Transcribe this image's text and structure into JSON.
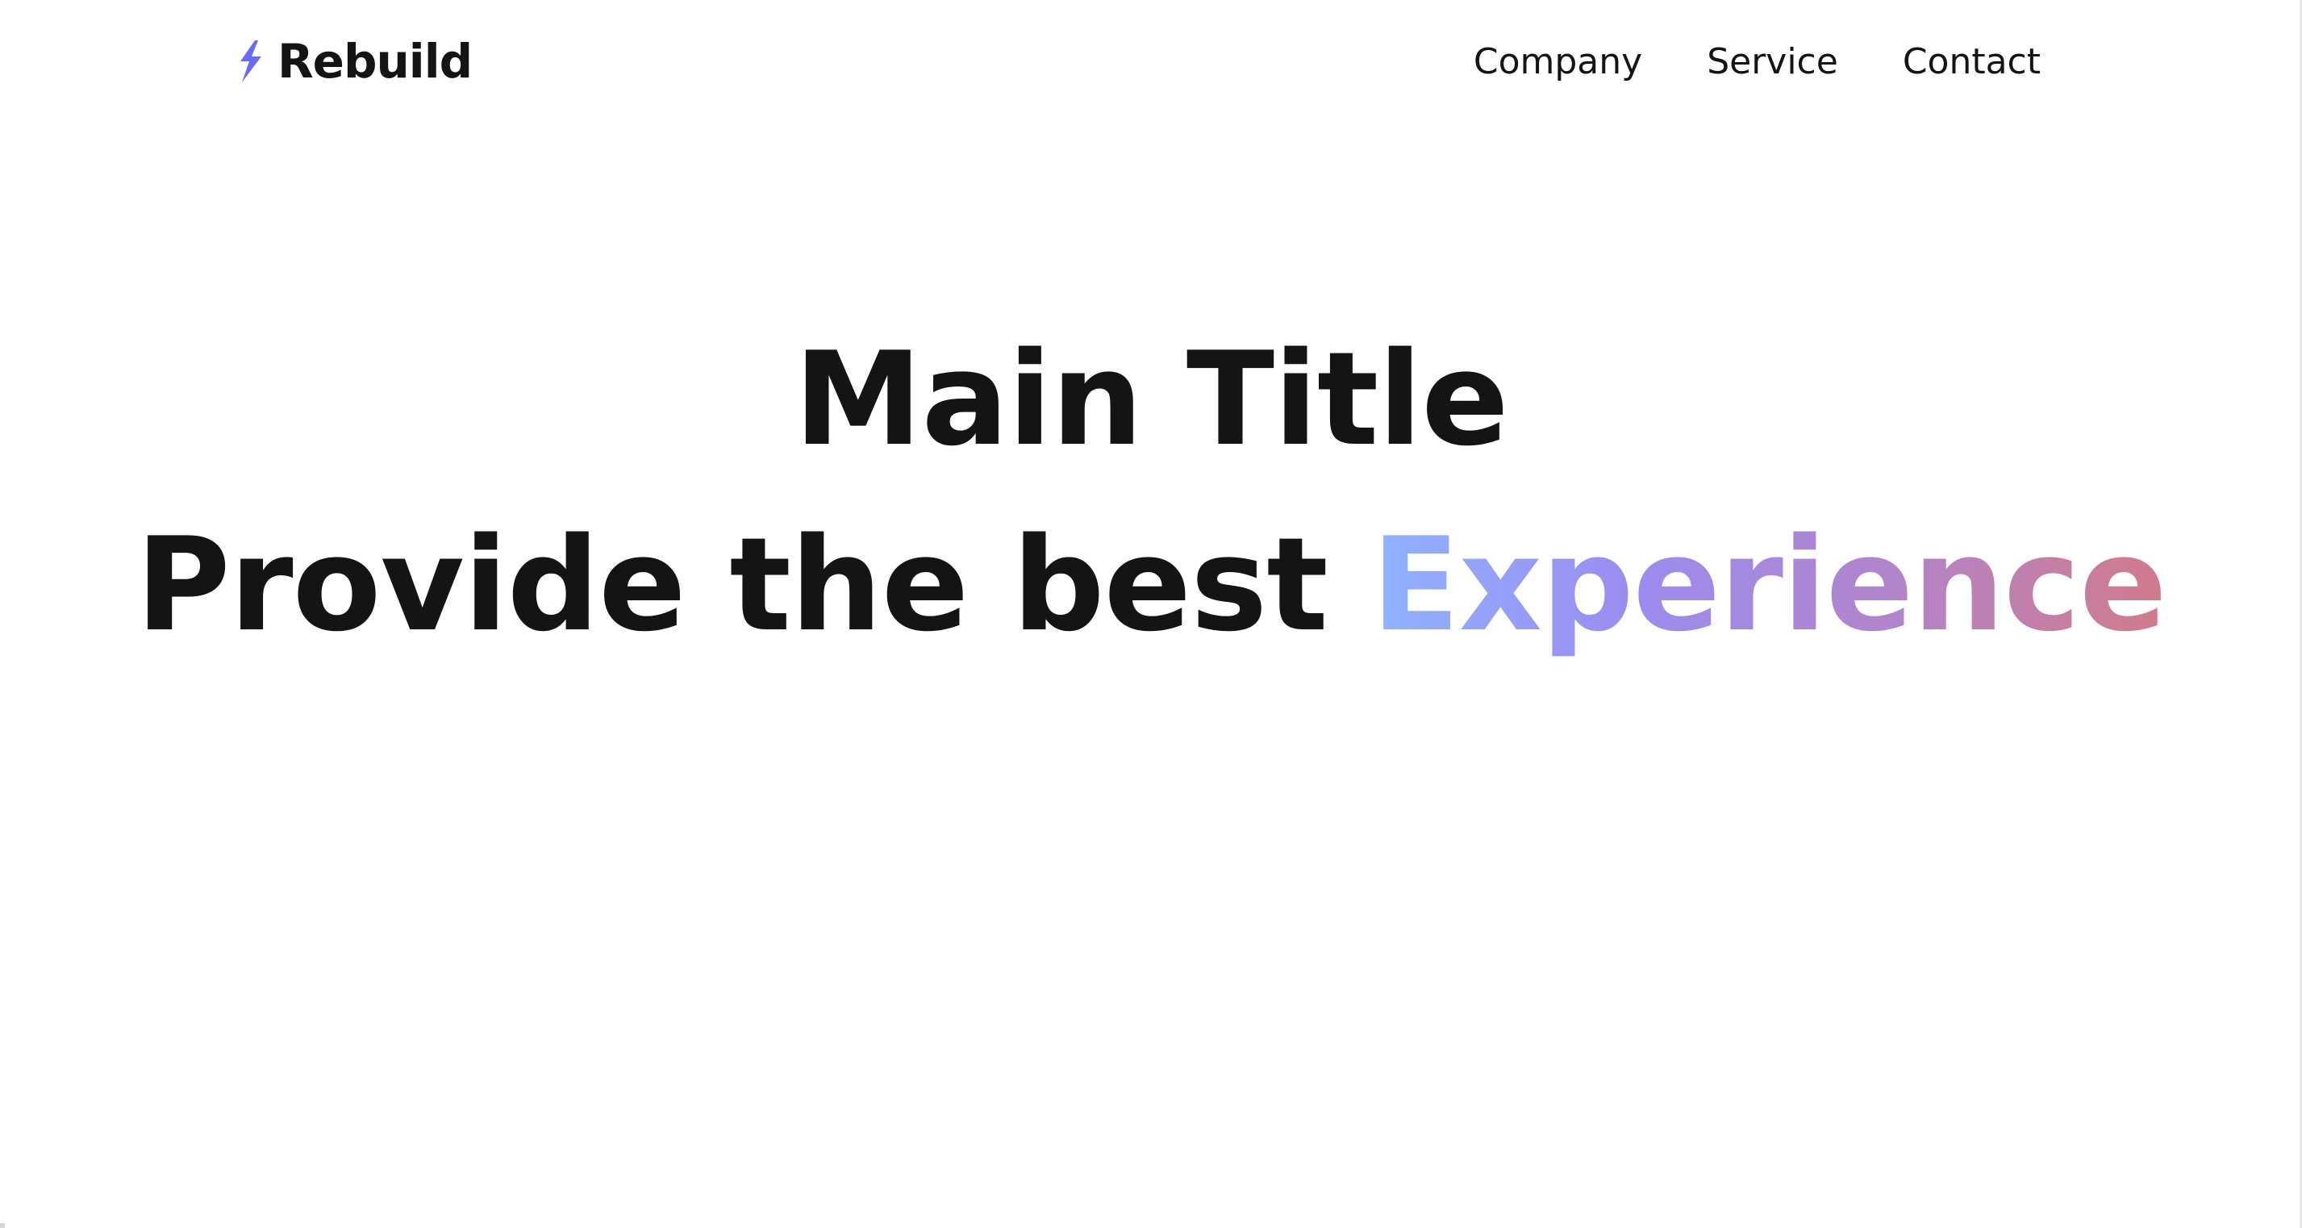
{
  "brand": {
    "name": "Rebuild",
    "icon": "lightning-bolt-icon",
    "icon_color": "#6a6cf6"
  },
  "nav": {
    "items": [
      {
        "label": "Company"
      },
      {
        "label": "Service"
      },
      {
        "label": "Contact"
      }
    ]
  },
  "hero": {
    "title_line1": "Main Title",
    "title_line2_prefix": "Provide the best ",
    "title_line2_accent": "Experience",
    "accent_gradient": [
      "#8fb3ff",
      "#9b8cf0",
      "#b384c8",
      "#d27a8a"
    ]
  }
}
